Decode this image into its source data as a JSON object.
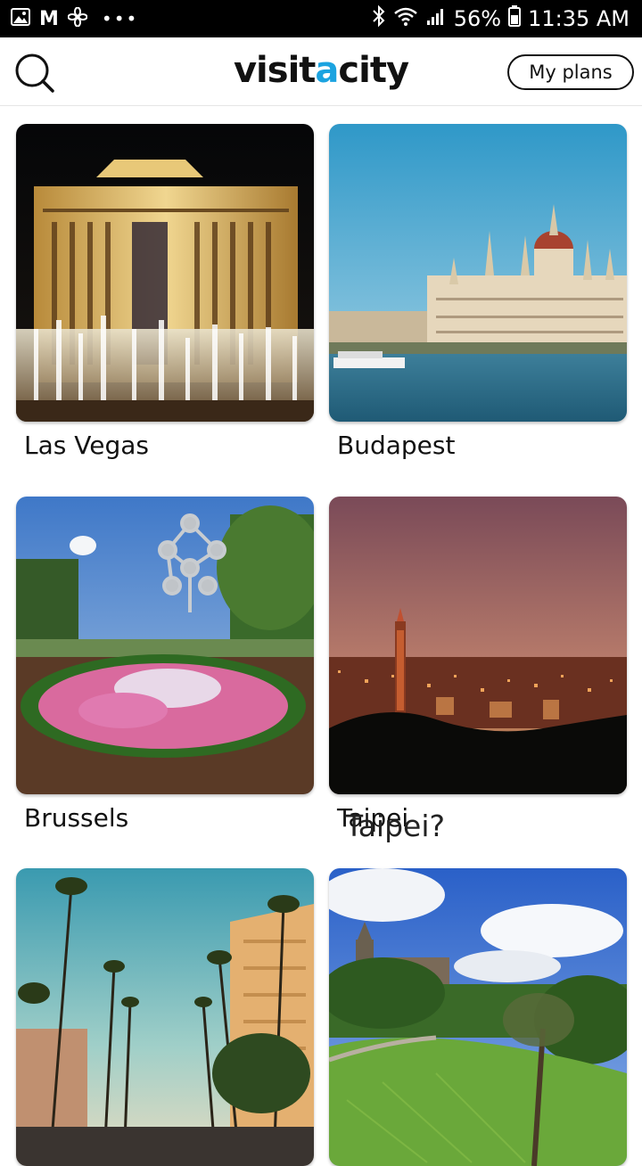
{
  "status_bar": {
    "battery": "56%",
    "time": "11:35 AM",
    "carrier_icon": "M",
    "overflow": "•••"
  },
  "header": {
    "logo_part1": "visit",
    "logo_accent": "a",
    "logo_part2": "city",
    "my_plans_label": "My plans"
  },
  "cities": [
    {
      "name": "Las Vegas"
    },
    {
      "name": "Budapest"
    },
    {
      "name": "Brussels"
    },
    {
      "name": "Taipei"
    },
    {
      "name": ""
    },
    {
      "name": ""
    }
  ],
  "overlay_text": "Taipei?",
  "colors": {
    "brand_accent": "#1ba3e0",
    "status_bar": "#000000"
  }
}
